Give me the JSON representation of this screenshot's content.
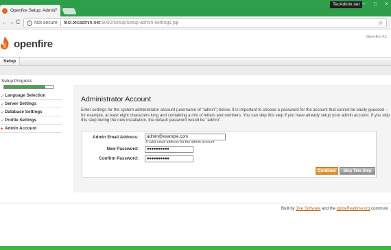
{
  "browser": {
    "tab_title": "Openfire Setup: Adminis",
    "tab_close": "×",
    "profile_name": "TecAdmin.net",
    "window_controls": [
      "–",
      "□",
      "×"
    ],
    "nav": {
      "back": "←",
      "forward": "→",
      "reload": "C"
    },
    "security_label": "Not secure",
    "url_host": "test.tecadmin.net",
    "url_path": ":9090/setup/setup-admin-settings.jsp",
    "accent_color": "#2e9e4b"
  },
  "header": {
    "logo_text": "openfire",
    "version": "Openfire 4.1",
    "nav_setup": "Setup"
  },
  "sidebar": {
    "title": "Setup Progress",
    "progress": 0.85,
    "items": [
      {
        "label": "Language Selection",
        "state": "done"
      },
      {
        "label": "Server Settings",
        "state": "done"
      },
      {
        "label": "Database Settings",
        "state": "done"
      },
      {
        "label": "Profile Settings",
        "state": "done"
      },
      {
        "label": "Admin Account",
        "state": "current"
      }
    ]
  },
  "main": {
    "title": "Administrator Account",
    "description": "Enter settings for the system administrator account (username of \"admin\") below. It is important to choose a password for the account that cannot be easily guessed -- for example, at least eight characters long and containing a mix of letters and numbers. You can skip this step if you have already setup your admin account. If you skip this step during the new installation, the default password would be \"admin\".",
    "form": {
      "email_label": "Admin Email Address:",
      "email_value": "admin@example.com",
      "email_hint": "A valid email address for the admin account.",
      "new_password_label": "New Password:",
      "new_password_value": "●●●●●●●●●●",
      "confirm_password_label": "Confirm Password:",
      "confirm_password_value": "●●●●●●●●●●"
    },
    "continue_label": "Continue",
    "skip_label": "Skip This Step"
  },
  "footer": {
    "prefix": "Built by",
    "link1": "Jive Software",
    "middle": "and the",
    "link2": "IgniteRealtime.org",
    "suffix": "communi"
  }
}
